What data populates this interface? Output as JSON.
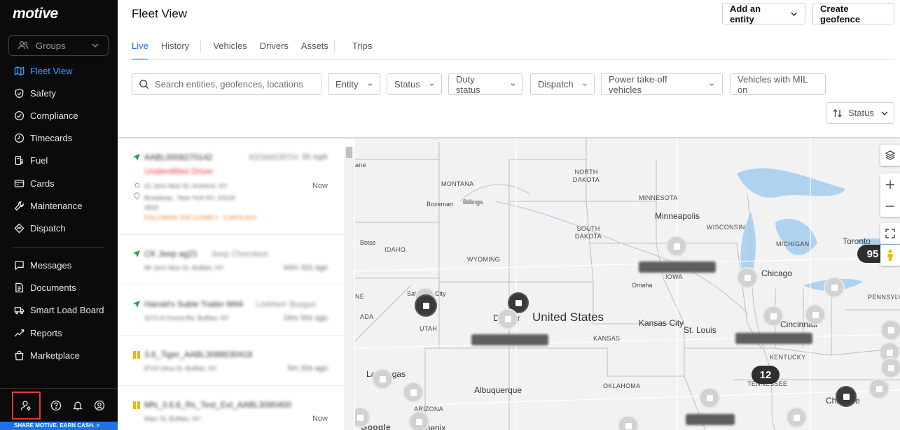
{
  "brand": {
    "logo": "motive"
  },
  "sidebar": {
    "groups_label": "Groups",
    "items": [
      {
        "label": "Fleet View",
        "icon": "map-icon",
        "active": true
      },
      {
        "label": "Safety",
        "icon": "shield-icon"
      },
      {
        "label": "Compliance",
        "icon": "check-circle-icon"
      },
      {
        "label": "Timecards",
        "icon": "clock-icon"
      },
      {
        "label": "Fuel",
        "icon": "fuel-icon"
      },
      {
        "label": "Cards",
        "icon": "card-icon"
      },
      {
        "label": "Maintenance",
        "icon": "wrench-icon"
      },
      {
        "label": "Dispatch",
        "icon": "dispatch-icon"
      },
      {
        "label": "Messages",
        "icon": "message-icon"
      },
      {
        "label": "Documents",
        "icon": "document-icon"
      },
      {
        "label": "Smart Load Board",
        "icon": "load-board-icon"
      },
      {
        "label": "Reports",
        "icon": "reports-icon"
      },
      {
        "label": "Marketplace",
        "icon": "marketplace-icon"
      }
    ],
    "share_banner": "SHARE MOTIVE. EARN CASH. >"
  },
  "header": {
    "title": "Fleet View",
    "add_entity": "Add an entity",
    "create_geofence": "Create geofence"
  },
  "tabs": [
    "Live",
    "History",
    "Vehicles",
    "Drivers",
    "Assets",
    "Trips"
  ],
  "filters": {
    "search_placeholder": "Search entities, geofences, locations",
    "entity": "Entity",
    "status": "Status",
    "duty_status": "Duty status",
    "dispatch": "Dispatch",
    "pto": "Power take-off vehicles",
    "mil": "Vehicles with MIL on",
    "sort": "Status"
  },
  "vehicles": [
    {
      "name": "AABL0008270142",
      "make": "KENWORTH",
      "driver": "Unidentified Driver",
      "addr1": "61 John Muir Dr, Amherst, NY",
      "addr2": "Broadway , New York NY, 10018",
      "addr3": "0818",
      "warn": "FOLLOWING TOO CLOSELY · 5 DAYS AGO",
      "right_top": "55 mph",
      "right_bottom": "Now",
      "status": "moving"
    },
    {
      "name": "CK Jeep ag21",
      "make": "Jeep Cherokee",
      "addr1": "Mt John Muir Dr, Buffalo, NY",
      "right_bottom": "44m 32s ago",
      "status": "moving"
    },
    {
      "name": "Harold's Suble Trailer M44",
      "make": "Liebherr Burgus",
      "addr1": "3273 N Forest Rd, Buffalo, NY",
      "right_bottom": "16m 50s ago",
      "status": "moving"
    },
    {
      "name": "3.6_Tiger_AABL3088530418",
      "make": "",
      "addr1": "8723 Utica St, Buffalo, NY",
      "right_bottom": "5m 20s ago",
      "status": "paused"
    },
    {
      "name": "MN_3.6.6_Rs_Test_Ext_AABL3090400",
      "make": "",
      "addr1": "Main St, Buffalo, NY",
      "right_bottom": "Now",
      "status": "paused"
    }
  ],
  "map": {
    "labels": {
      "montana": "MONTANA",
      "north_dakota": "NORTH DAKOTA",
      "minnesota": "MINNESOTA",
      "minneapolis": "Minneapolis",
      "wisconsin": "WISCONSIN",
      "bozeman": "Bozeman",
      "billings": "Billings",
      "south_dakota": "SOUTH DAKOTA",
      "idaho": "IDAHO",
      "boise": "Boise",
      "michigan": "MICHIGAN",
      "toronto": "Toronto",
      "wyoming": "WYOMING",
      "iowa": "IOWA",
      "omaha": "Omaha",
      "chicago": "Chicago",
      "utah": "UTAH",
      "salt_lake": "Salt Lake City",
      "denver": "Denver",
      "united_states": "United States",
      "kansas_city": "Kansas City",
      "st_louis": "St. Louis",
      "cincinnati": "Cincinnati",
      "pennsylvania": "PENNSYLVANIA",
      "kansas": "KANSAS",
      "kentucky": "KENTUCKY",
      "tennessee": "TENNESSEE",
      "las_vegas": "Las Vegas",
      "albuquerque": "Albuquerque",
      "oklahoma": "OKLAHOMA",
      "arizona": "ARIZONA",
      "phoenix": "Phoenix",
      "charlotte": "Charlotte",
      "nevada": "ADA",
      "nebraska": "NE",
      "lane": "ane",
      "google": "Google"
    },
    "clusters": {
      "east": "95",
      "south": "12"
    }
  }
}
